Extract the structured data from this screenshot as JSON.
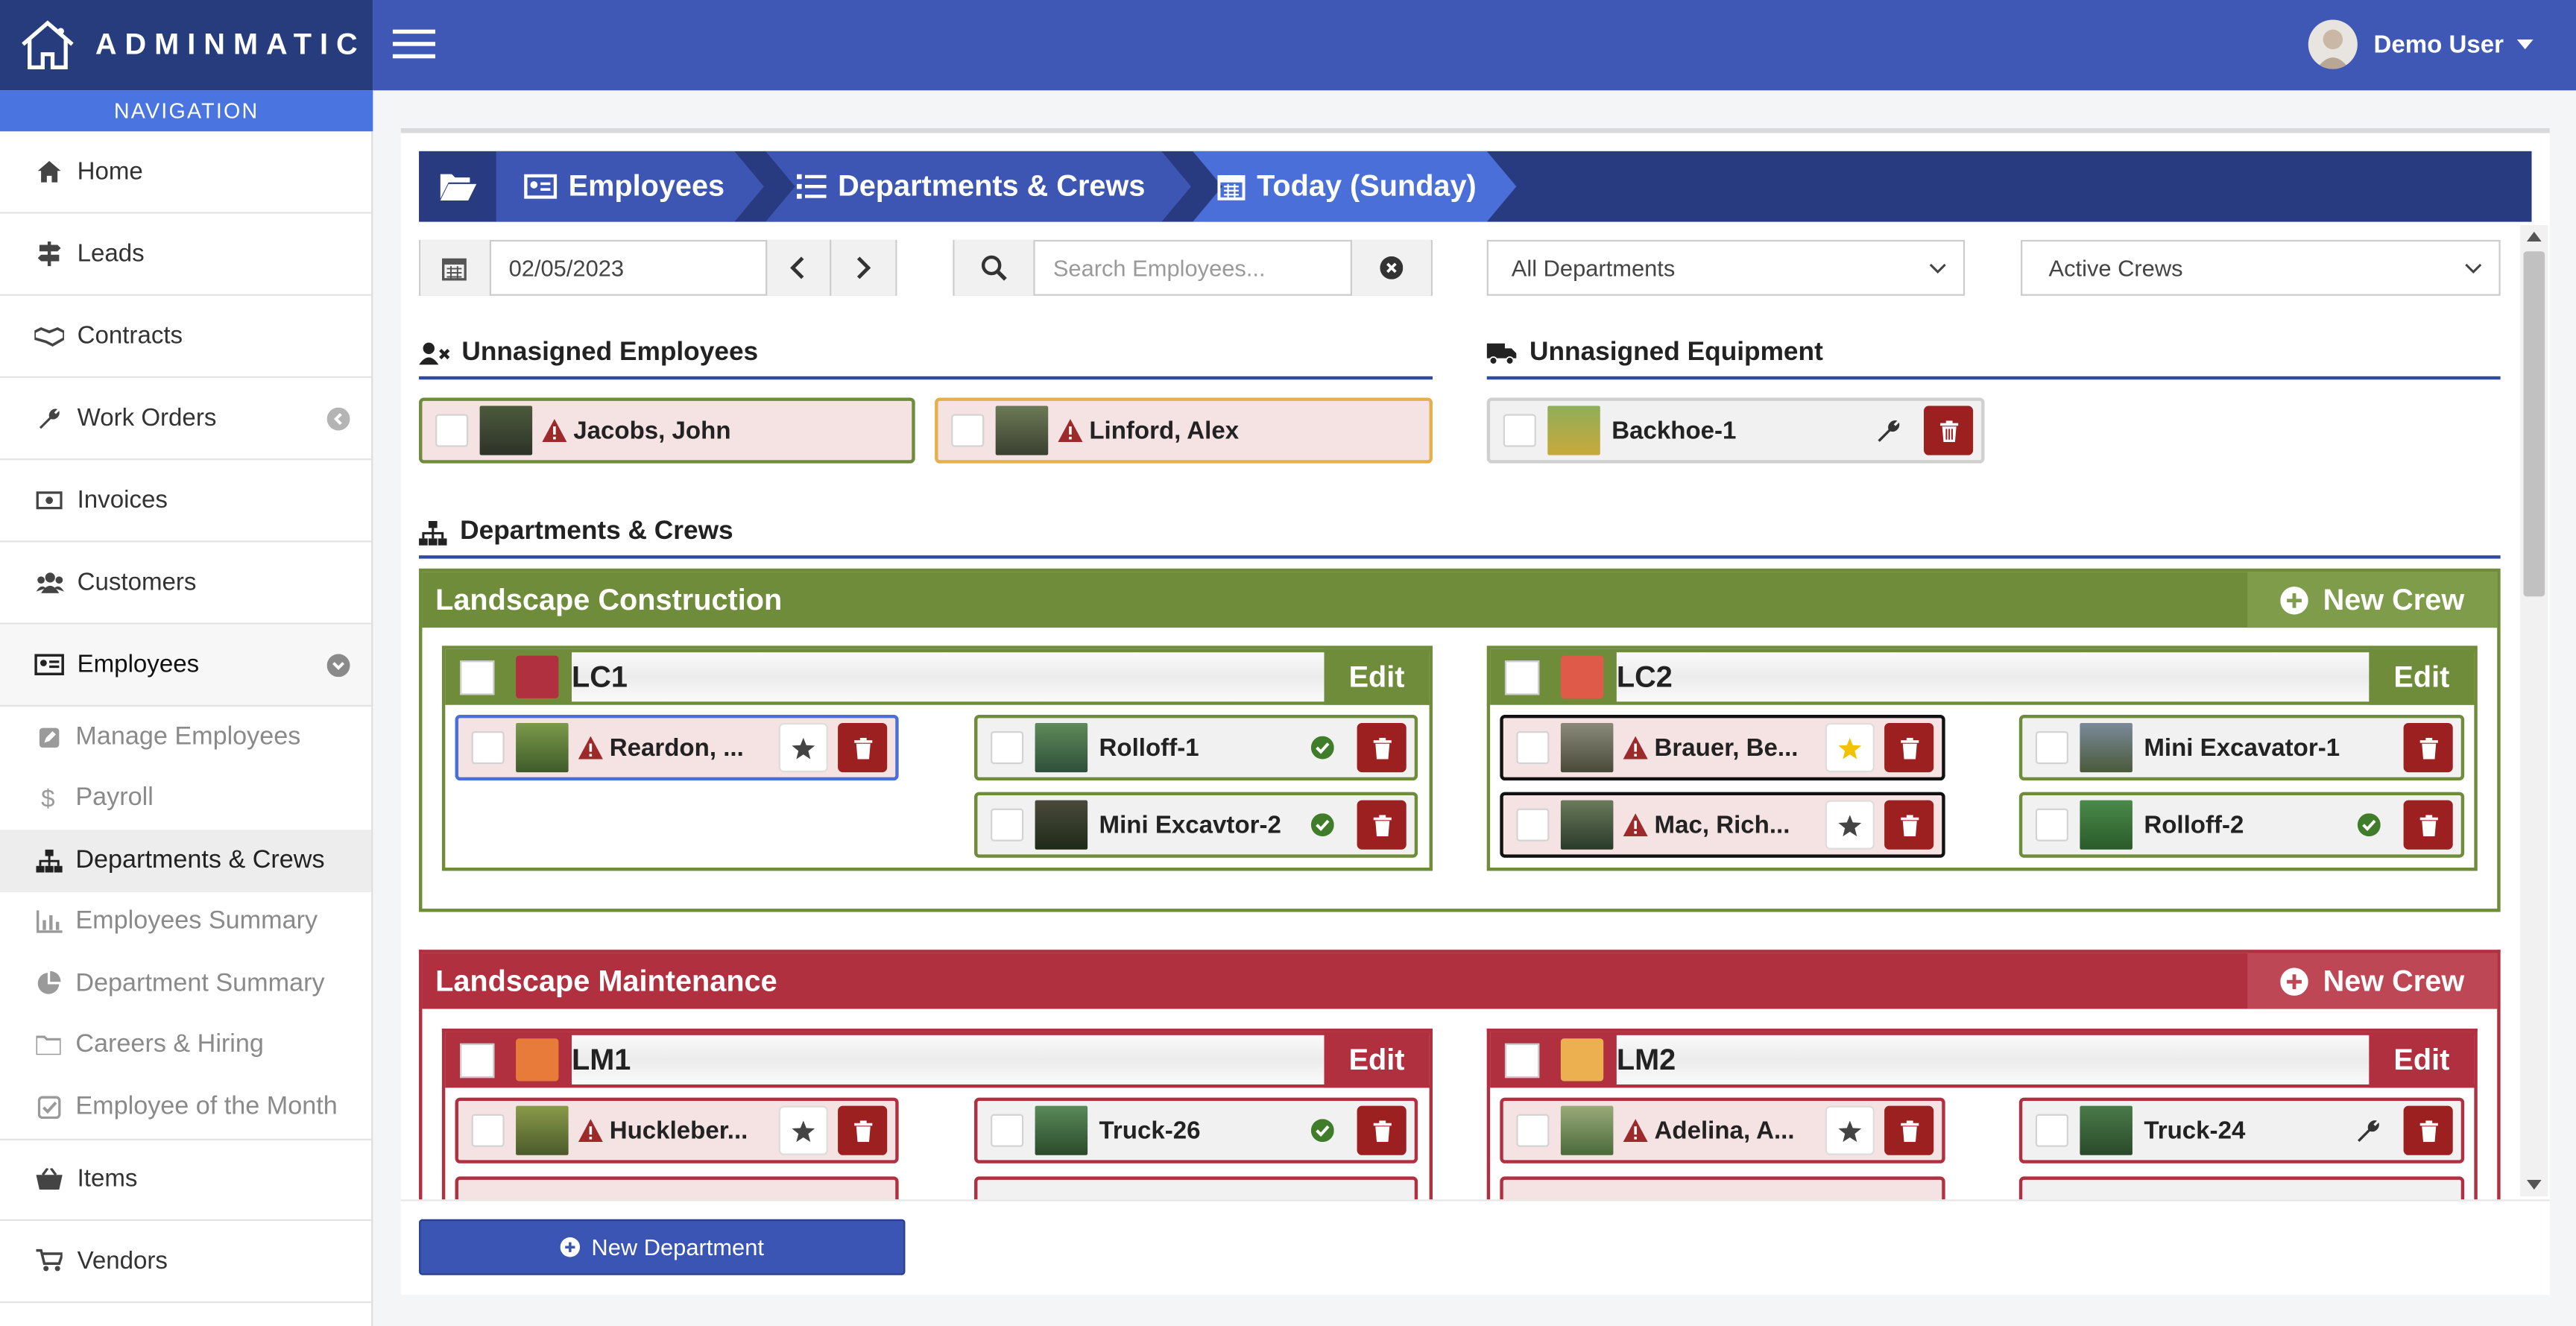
{
  "app": {
    "logo_text": "ADMINMATIC",
    "user_name": "Demo User"
  },
  "sidebar": {
    "header": "NAVIGATION",
    "items": [
      {
        "label": "Home"
      },
      {
        "label": "Leads"
      },
      {
        "label": "Contracts"
      },
      {
        "label": "Work Orders"
      },
      {
        "label": "Invoices"
      },
      {
        "label": "Customers"
      },
      {
        "label": "Employees"
      }
    ],
    "sub_items": [
      {
        "label": "Manage Employees"
      },
      {
        "label": "Payroll"
      },
      {
        "label": "Departments & Crews"
      },
      {
        "label": "Employees Summary"
      },
      {
        "label": "Department Summary"
      },
      {
        "label": "Careers & Hiring"
      },
      {
        "label": "Employee of the Month"
      }
    ],
    "bottom_items": [
      {
        "label": "Items"
      },
      {
        "label": "Vendors"
      }
    ]
  },
  "breadcrumb": {
    "items": [
      "Employees",
      "Departments & Crews",
      "Today (Sunday)"
    ]
  },
  "filters": {
    "date": "02/05/2023",
    "search_placeholder": "Search Employees...",
    "department": "All Departments",
    "crews": "Active Crews"
  },
  "unassigned": {
    "employees_title": "Unnasigned Employees",
    "equipment_title": "Unnasigned Equipment",
    "employees": [
      "Jacobs, John",
      "Linford, Alex"
    ],
    "equipment": [
      "Backhoe-1"
    ]
  },
  "departments_title": "Departments & Crews",
  "departments": [
    {
      "name": "Landscape Construction",
      "new_crew": "New Crew",
      "crews": [
        {
          "name": "LC1",
          "edit": "Edit",
          "employees": [
            "Reardon, ..."
          ],
          "equipment": [
            "Rolloff-1",
            "Mini Excavtor-2"
          ]
        },
        {
          "name": "LC2",
          "edit": "Edit",
          "employees": [
            "Brauer, Be...",
            "Mac, Rich..."
          ],
          "equipment": [
            "Mini Excavator-1",
            "Rolloff-2"
          ]
        }
      ]
    },
    {
      "name": "Landscape Maintenance",
      "new_crew": "New Crew",
      "crews": [
        {
          "name": "LM1",
          "edit": "Edit",
          "employees": [
            "Huckleber..."
          ],
          "equipment": [
            "Truck-26"
          ]
        },
        {
          "name": "LM2",
          "edit": "Edit",
          "employees": [
            "Adelina, A..."
          ],
          "equipment": [
            "Truck-24"
          ]
        }
      ]
    }
  ],
  "new_department": "New Department",
  "colors": {
    "header": "#3f58b5",
    "logo": "#263c7c",
    "green": "#6e8c3a",
    "red": "#b03040",
    "crumb": "#283b80",
    "lc1": "#b03040",
    "lc2": "#e05a4a",
    "lm1": "#e87a3a",
    "lm2": "#ecb050"
  }
}
